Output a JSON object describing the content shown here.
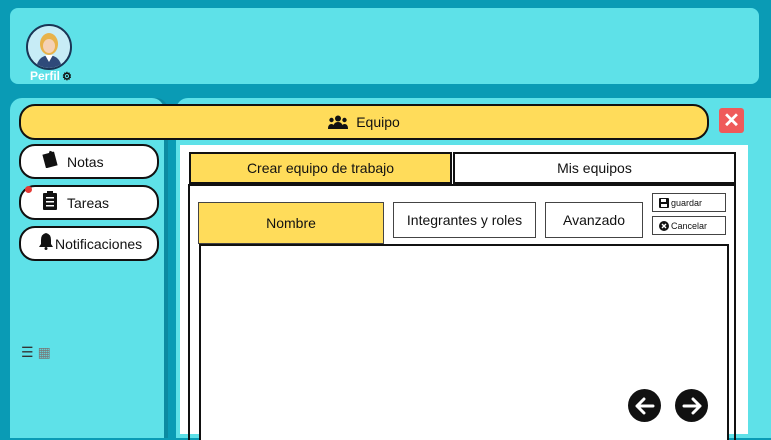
{
  "profile": {
    "label": "Perfil"
  },
  "header": {
    "title": "Equipo"
  },
  "sidebar": {
    "items": [
      {
        "label": "Notas",
        "icon": "notes-icon"
      },
      {
        "label": "Tareas",
        "icon": "clipboard-icon",
        "badge": true
      },
      {
        "label": "Notificaciones",
        "icon": "bell-icon"
      }
    ]
  },
  "tabs": {
    "create": "Crear equipo de trabajo",
    "mine": "Mis equipos"
  },
  "subtabs": {
    "name": "Nombre",
    "members": "Integrantes y roles",
    "advanced": "Avanzado"
  },
  "actions": {
    "save": "guardar",
    "cancel": "Cancelar"
  },
  "colors": {
    "background": "#0a9bb5",
    "panel": "#5ee1e8",
    "accent": "#ffdc5a",
    "close": "#ef5a5a"
  }
}
